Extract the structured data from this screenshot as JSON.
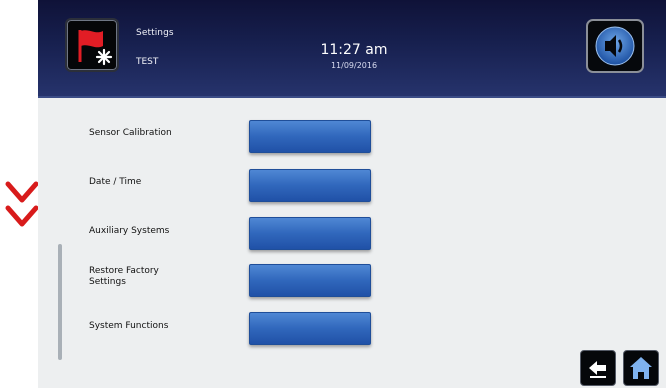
{
  "header": {
    "mode_title": "Settings",
    "mode_subtitle": "TEST",
    "time": "11:27 am",
    "date": "11/09/2016",
    "mode_icon": "flag-icon",
    "volume_icon": "speaker-icon"
  },
  "menu": {
    "items": [
      {
        "label": "Sensor Calibration",
        "button_label": ""
      },
      {
        "label": "Date / Time",
        "button_label": ""
      },
      {
        "label": "Auxiliary Systems",
        "button_label": ""
      },
      {
        "label": "Restore Factory Settings",
        "button_label": ""
      },
      {
        "label": "System Functions",
        "button_label": ""
      }
    ]
  },
  "footer": {
    "back_icon": "back-arrow-icon",
    "home_icon": "home-icon"
  },
  "colors": {
    "header_dark": "#0f1238",
    "header_light": "#26336c",
    "button_blue": "#3067bc",
    "scroll_chevron_red": "#d81b1b",
    "flag_red": "#e21d25"
  },
  "overlay": {
    "scroll_indicator_icon": "double-chevron-down-icon"
  }
}
